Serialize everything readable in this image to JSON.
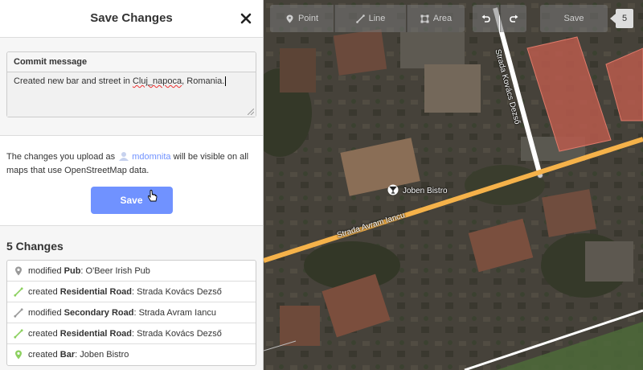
{
  "sidebar": {
    "title": "Save Changes",
    "commit": {
      "label": "Commit message",
      "text_before": "Created new bar and street in ",
      "text_misspelled": "Cluj_napoca",
      "text_after": ", Romania."
    },
    "upload": {
      "text_before": "The changes you upload as",
      "username": "mdomnita",
      "text_after": "will be visible on all maps that use OpenStreetMap data.",
      "save_label": "Save"
    },
    "changes": {
      "title": "5 Changes",
      "items": [
        {
          "action": "modified",
          "type": "Pub",
          "name": "O'Beer Irish Pub",
          "icon": "pin-icon"
        },
        {
          "action": "created",
          "type": "Residential Road",
          "name": "Strada Kovács Dezső",
          "icon": "line-icon"
        },
        {
          "action": "modified",
          "type": "Secondary Road",
          "name": "Strada Avram Iancu",
          "icon": "line-icon"
        },
        {
          "action": "created",
          "type": "Residential Road",
          "name": "Strada Kovács Dezső",
          "icon": "line-icon"
        },
        {
          "action": "created",
          "type": "Bar",
          "name": "Joben Bistro",
          "icon": "pin-icon"
        }
      ]
    }
  },
  "toolbar": {
    "point_label": "Point",
    "line_label": "Line",
    "area_label": "Area",
    "save_label": "Save",
    "count": "5"
  },
  "map": {
    "poi_label": "Joben Bistro",
    "street_avram": "Strada Avram Iancu",
    "street_kovacs": "Strada Kovács Dezső"
  },
  "colors": {
    "accent": "#7092ff",
    "secondary_road": "#f5b24a",
    "created": "#8cd05f",
    "modified": "#999999"
  }
}
